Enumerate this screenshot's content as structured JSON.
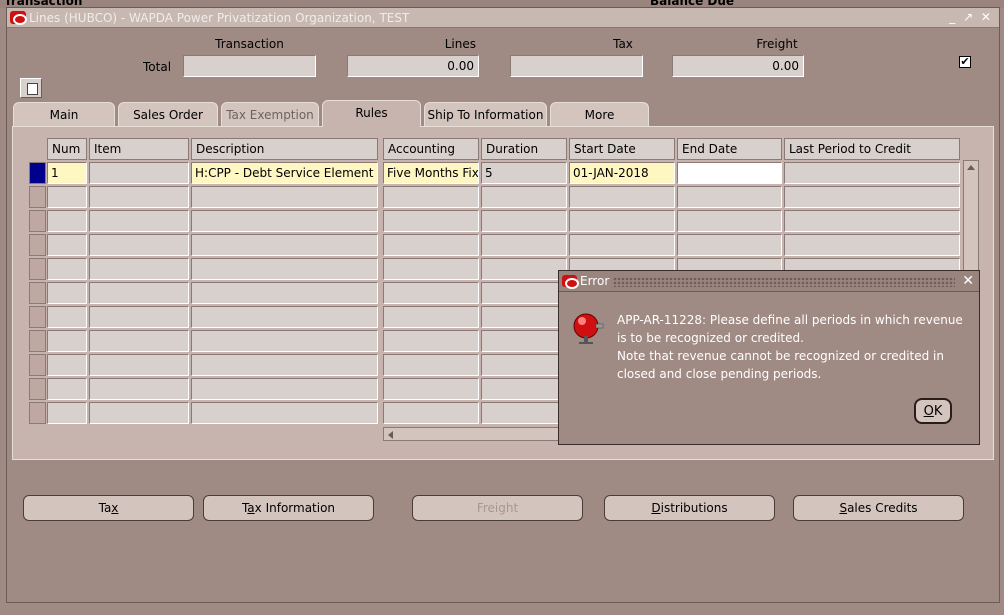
{
  "background": {
    "left_text": "Transaction",
    "right_text": "Balance Due"
  },
  "window": {
    "title": "Lines (HUBCO) - WAPDA Power Privatization Organization, TEST",
    "controls": "_ ↗ ✕"
  },
  "totals": {
    "headers": {
      "transaction": "Transaction",
      "lines": "Lines",
      "tax": "Tax",
      "freight": "Freight"
    },
    "row_label": "Total",
    "transaction": "",
    "lines": "0.00",
    "tax": "",
    "freight": "0.00",
    "checkbox": "✔"
  },
  "tabs": [
    {
      "label": "Main"
    },
    {
      "label": "Sales Order"
    },
    {
      "label": "Tax Exemption"
    },
    {
      "label": "Rules"
    },
    {
      "label": "Ship To Information"
    },
    {
      "label": "More"
    }
  ],
  "grid": {
    "columns": [
      "Num",
      "Item",
      "Description",
      "Accounting",
      "Duration",
      "Start Date",
      "End Date",
      "Last Period to Credit"
    ],
    "row1": {
      "num": "1",
      "item": "",
      "description": "H:CPP - Debt Service Element",
      "accounting": "Five Months Fix",
      "duration": "5",
      "start_date": "01-JAN-2018",
      "end_date": "",
      "last_period": ""
    }
  },
  "buttons": {
    "tax": {
      "pre": "Ta",
      "ul": "x",
      "post": ""
    },
    "tax_info": {
      "pre": "T",
      "ul": "a",
      "post": "x Information"
    },
    "freight": {
      "pre": "",
      "ul": "",
      "post": "Freight"
    },
    "distributions": {
      "pre": "",
      "ul": "D",
      "post": "istributions"
    },
    "sales_credits": {
      "pre": "",
      "ul": "S",
      "post": "ales Credits"
    }
  },
  "dialog": {
    "title": "Error",
    "close": "✕",
    "message_line1": "APP-AR-11228: Please define all periods in which revenue is to be recognized or credited.",
    "message_line2": "Note that revenue cannot be recognized or credited in closed and close pending periods.",
    "ok": {
      "pre": "",
      "ul": "O",
      "post": "K"
    }
  },
  "colors": {
    "window_bg": "#a08a84",
    "panel_bg": "#c8b4ae",
    "required_field": "#fff7c2",
    "current_row": "#00008c",
    "alert_icon": "#d01010"
  }
}
